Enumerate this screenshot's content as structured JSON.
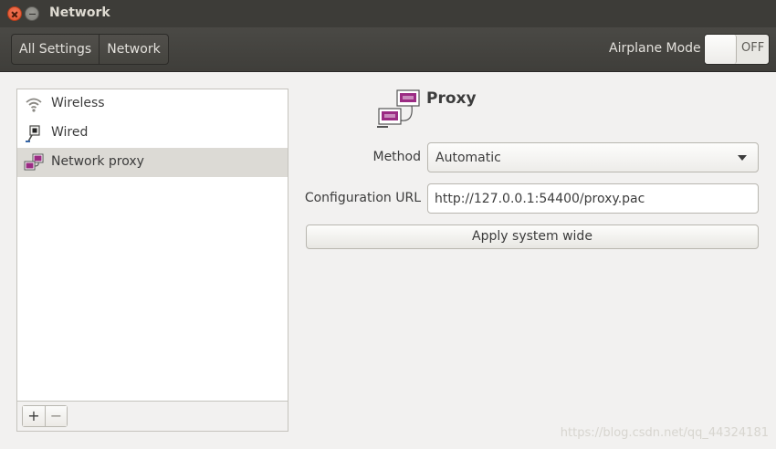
{
  "window": {
    "title": "Network",
    "close_icon": "close-icon",
    "minimize_icon": "minimize-icon"
  },
  "header": {
    "breadcrumbs": [
      "All Settings",
      "Network"
    ],
    "airplane_label": "Airplane Mode",
    "airplane_state": "OFF"
  },
  "sidebar": {
    "items": [
      {
        "label": "Wireless",
        "icon": "wifi-icon"
      },
      {
        "label": "Wired",
        "icon": "wired-network-icon"
      },
      {
        "label": "Network proxy",
        "icon": "proxy-icon",
        "selected": true
      }
    ],
    "add_label": "+",
    "remove_label": "−"
  },
  "panel": {
    "title": "Proxy",
    "method_label": "Method",
    "method_value": "Automatic",
    "config_url_label": "Configuration URL",
    "config_url_value": "http://127.0.0.1:54400/proxy.pac",
    "apply_label": "Apply system wide"
  },
  "watermark": "https://blog.csdn.net/qq_44324181",
  "colors": {
    "titlebar": "#3d3c38",
    "close_button": "#e0502a",
    "selected_row": "#dcdad5",
    "proxy_icon": "#9b2b83"
  }
}
